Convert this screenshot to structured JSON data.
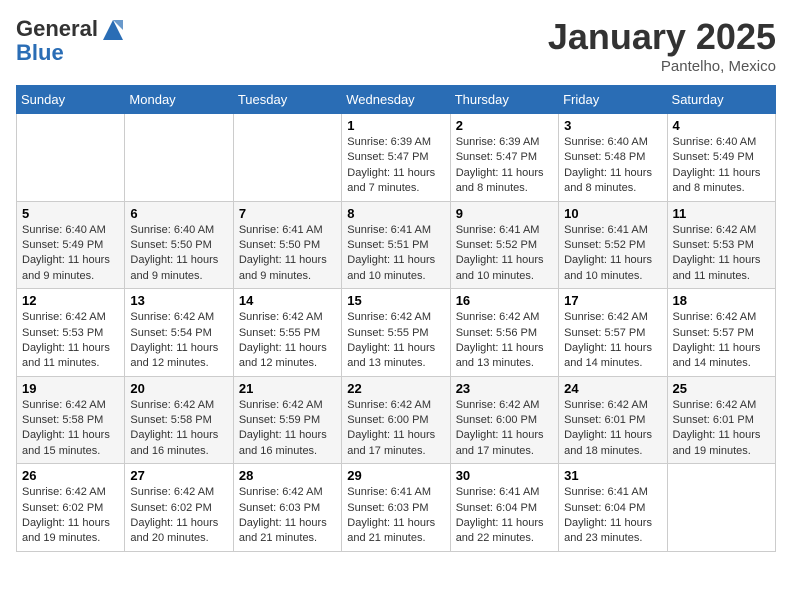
{
  "header": {
    "logo_line1": "General",
    "logo_line2": "Blue",
    "month_title": "January 2025",
    "location": "Pantelho, Mexico"
  },
  "days_of_week": [
    "Sunday",
    "Monday",
    "Tuesday",
    "Wednesday",
    "Thursday",
    "Friday",
    "Saturday"
  ],
  "weeks": [
    [
      {
        "day": "",
        "info": ""
      },
      {
        "day": "",
        "info": ""
      },
      {
        "day": "",
        "info": ""
      },
      {
        "day": "1",
        "info": "Sunrise: 6:39 AM\nSunset: 5:47 PM\nDaylight: 11 hours and 7 minutes."
      },
      {
        "day": "2",
        "info": "Sunrise: 6:39 AM\nSunset: 5:47 PM\nDaylight: 11 hours and 8 minutes."
      },
      {
        "day": "3",
        "info": "Sunrise: 6:40 AM\nSunset: 5:48 PM\nDaylight: 11 hours and 8 minutes."
      },
      {
        "day": "4",
        "info": "Sunrise: 6:40 AM\nSunset: 5:49 PM\nDaylight: 11 hours and 8 minutes."
      }
    ],
    [
      {
        "day": "5",
        "info": "Sunrise: 6:40 AM\nSunset: 5:49 PM\nDaylight: 11 hours and 9 minutes."
      },
      {
        "day": "6",
        "info": "Sunrise: 6:40 AM\nSunset: 5:50 PM\nDaylight: 11 hours and 9 minutes."
      },
      {
        "day": "7",
        "info": "Sunrise: 6:41 AM\nSunset: 5:50 PM\nDaylight: 11 hours and 9 minutes."
      },
      {
        "day": "8",
        "info": "Sunrise: 6:41 AM\nSunset: 5:51 PM\nDaylight: 11 hours and 10 minutes."
      },
      {
        "day": "9",
        "info": "Sunrise: 6:41 AM\nSunset: 5:52 PM\nDaylight: 11 hours and 10 minutes."
      },
      {
        "day": "10",
        "info": "Sunrise: 6:41 AM\nSunset: 5:52 PM\nDaylight: 11 hours and 10 minutes."
      },
      {
        "day": "11",
        "info": "Sunrise: 6:42 AM\nSunset: 5:53 PM\nDaylight: 11 hours and 11 minutes."
      }
    ],
    [
      {
        "day": "12",
        "info": "Sunrise: 6:42 AM\nSunset: 5:53 PM\nDaylight: 11 hours and 11 minutes."
      },
      {
        "day": "13",
        "info": "Sunrise: 6:42 AM\nSunset: 5:54 PM\nDaylight: 11 hours and 12 minutes."
      },
      {
        "day": "14",
        "info": "Sunrise: 6:42 AM\nSunset: 5:55 PM\nDaylight: 11 hours and 12 minutes."
      },
      {
        "day": "15",
        "info": "Sunrise: 6:42 AM\nSunset: 5:55 PM\nDaylight: 11 hours and 13 minutes."
      },
      {
        "day": "16",
        "info": "Sunrise: 6:42 AM\nSunset: 5:56 PM\nDaylight: 11 hours and 13 minutes."
      },
      {
        "day": "17",
        "info": "Sunrise: 6:42 AM\nSunset: 5:57 PM\nDaylight: 11 hours and 14 minutes."
      },
      {
        "day": "18",
        "info": "Sunrise: 6:42 AM\nSunset: 5:57 PM\nDaylight: 11 hours and 14 minutes."
      }
    ],
    [
      {
        "day": "19",
        "info": "Sunrise: 6:42 AM\nSunset: 5:58 PM\nDaylight: 11 hours and 15 minutes."
      },
      {
        "day": "20",
        "info": "Sunrise: 6:42 AM\nSunset: 5:58 PM\nDaylight: 11 hours and 16 minutes."
      },
      {
        "day": "21",
        "info": "Sunrise: 6:42 AM\nSunset: 5:59 PM\nDaylight: 11 hours and 16 minutes."
      },
      {
        "day": "22",
        "info": "Sunrise: 6:42 AM\nSunset: 6:00 PM\nDaylight: 11 hours and 17 minutes."
      },
      {
        "day": "23",
        "info": "Sunrise: 6:42 AM\nSunset: 6:00 PM\nDaylight: 11 hours and 17 minutes."
      },
      {
        "day": "24",
        "info": "Sunrise: 6:42 AM\nSunset: 6:01 PM\nDaylight: 11 hours and 18 minutes."
      },
      {
        "day": "25",
        "info": "Sunrise: 6:42 AM\nSunset: 6:01 PM\nDaylight: 11 hours and 19 minutes."
      }
    ],
    [
      {
        "day": "26",
        "info": "Sunrise: 6:42 AM\nSunset: 6:02 PM\nDaylight: 11 hours and 19 minutes."
      },
      {
        "day": "27",
        "info": "Sunrise: 6:42 AM\nSunset: 6:02 PM\nDaylight: 11 hours and 20 minutes."
      },
      {
        "day": "28",
        "info": "Sunrise: 6:42 AM\nSunset: 6:03 PM\nDaylight: 11 hours and 21 minutes."
      },
      {
        "day": "29",
        "info": "Sunrise: 6:41 AM\nSunset: 6:03 PM\nDaylight: 11 hours and 21 minutes."
      },
      {
        "day": "30",
        "info": "Sunrise: 6:41 AM\nSunset: 6:04 PM\nDaylight: 11 hours and 22 minutes."
      },
      {
        "day": "31",
        "info": "Sunrise: 6:41 AM\nSunset: 6:04 PM\nDaylight: 11 hours and 23 minutes."
      },
      {
        "day": "",
        "info": ""
      }
    ]
  ]
}
